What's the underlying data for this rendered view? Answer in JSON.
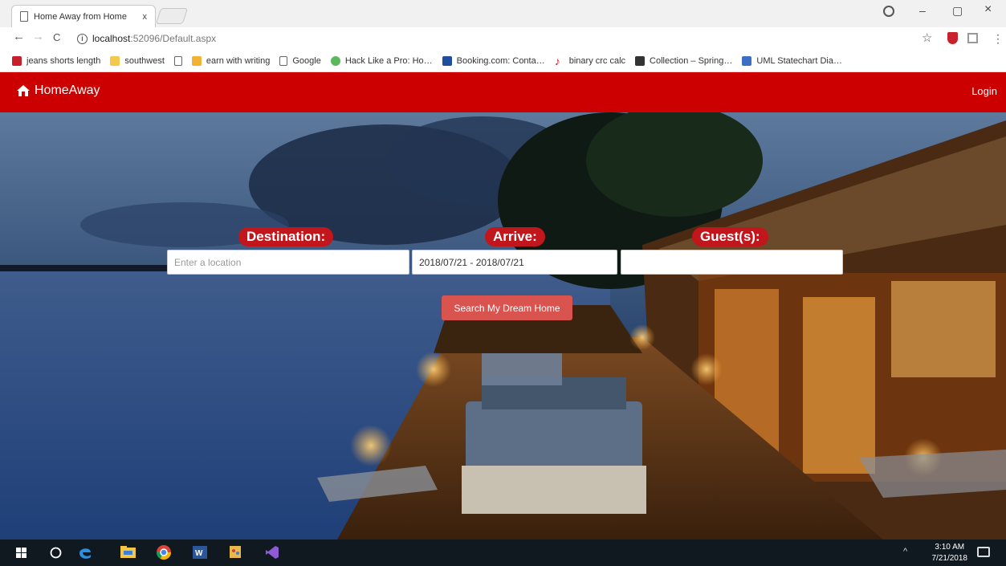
{
  "browser": {
    "tab_title": "Home Away from Home",
    "tab_close": "x",
    "url_host": "localhost",
    "url_rest": ":52096/Default.aspx",
    "window": {
      "minimize": "–",
      "maximize": "▢",
      "close": "×"
    },
    "toolbar": {
      "back": "←",
      "forward": "→",
      "reload": "C",
      "star": "☆",
      "menu": "⋮"
    }
  },
  "bookmarks": [
    {
      "label": "jeans shorts length",
      "icon": "red-square-icon",
      "color": "#c8202a"
    },
    {
      "label": "southwest",
      "icon": "folder-icon",
      "color": "#f2c94c"
    },
    {
      "label": "earn with writing",
      "icon": "edit-icon",
      "color": "#f2b233"
    },
    {
      "label": "Google",
      "icon": "page-icon",
      "color": "#ffffff"
    },
    {
      "label": "Hack Like a Pro: Ho…",
      "icon": "gadget-icon",
      "color": "#5cb85c"
    },
    {
      "label": "Booking.com: Conta…",
      "icon": "booking-icon",
      "color": "#1f4e9c"
    },
    {
      "label": "binary crc calc",
      "icon": "crc-icon",
      "color": "#d9141b"
    },
    {
      "label": "Collection – Spring…",
      "icon": "collection-icon",
      "color": "#333333"
    },
    {
      "label": "UML Statechart Dia…",
      "icon": "uml-icon",
      "color": "#3b6fc4"
    }
  ],
  "site": {
    "brand": "HomeAway",
    "login": "Login",
    "colors": {
      "header": "#cc0000",
      "label_bg": "#c0161c",
      "button_bg": "#d9534f"
    }
  },
  "search": {
    "destination_label": "Destination:",
    "destination_placeholder": "Enter a location",
    "arrive_label": "Arrive:",
    "arrive_value": "2018/07/21 - 2018/07/21",
    "guests_label": "Guest(s):",
    "guests_value": "",
    "submit_label": "Search My Dream Home"
  },
  "taskbar": {
    "time": "3:10 AM",
    "date": "7/21/2018",
    "apps": [
      "windows-start-icon",
      "cortana-icon",
      "edge-icon",
      "file-explorer-icon",
      "chrome-icon",
      "word-icon",
      "paint-icon",
      "visual-studio-icon"
    ]
  }
}
